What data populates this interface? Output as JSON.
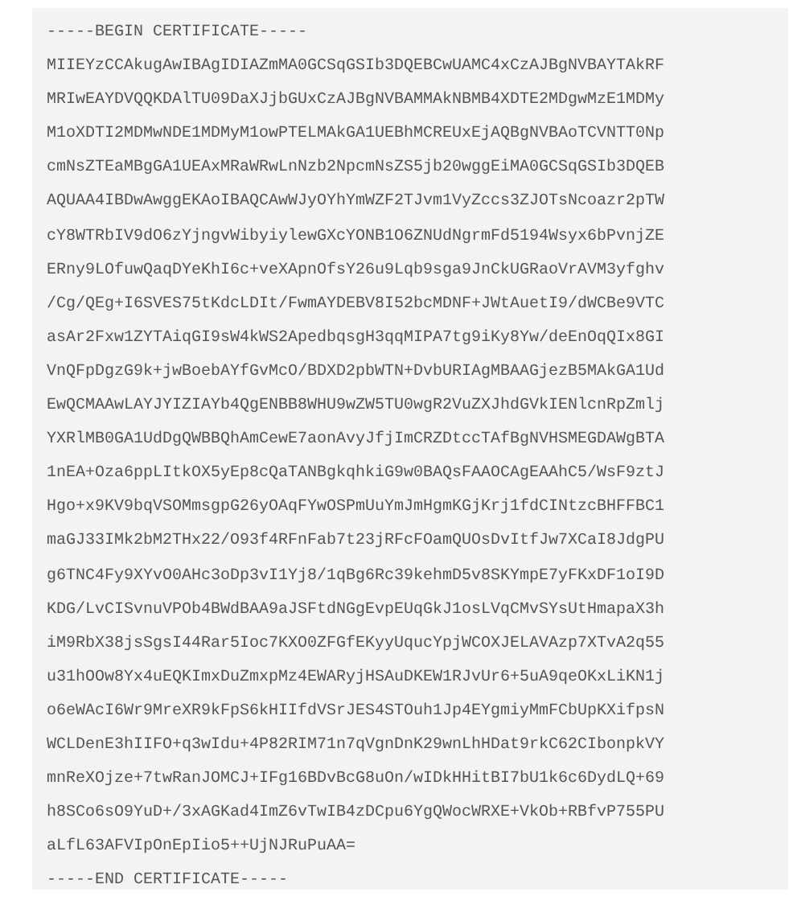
{
  "certificate": {
    "lines": [
      "-----BEGIN CERTIFICATE-----",
      "MIIEYzCCAkugAwIBAgIDIAZmMA0GCSqGSIb3DQEBCwUAMC4xCzAJBgNVBAYTAkRF",
      "MRIwEAYDVQQKDAlTU09DaXJjbGUxCzAJBgNVBAMMAkNBMB4XDTE2MDgwMzE1MDMy",
      "M1oXDTI2MDMwNDE1MDMyM1owPTELMAkGA1UEBhMCREUxEjAQBgNVBAoTCVNTT0Np",
      "cmNsZTEaMBgGA1UEAxMRaWRwLnNzb2NpcmNsZS5jb20wggEiMA0GCSqGSIb3DQEB",
      "AQUAA4IBDwAwggEKAoIBAQCAwWJyOYhYmWZF2TJvm1VyZccs3ZJOTsNcoazr2pTW",
      "cY8WTRbIV9dO6zYjngvWibyiylewGXcYONB1O6ZNUdNgrmFd5194Wsyx6bPvnjZE",
      "ERny9LOfuwQaqDYeKhI6c+veXApnOfsY26u9Lqb9sga9JnCkUGRaoVrAVM3yfghv",
      "/Cg/QEg+I6SVES75tKdcLDIt/FwmAYDEBV8I52bcMDNF+JWtAuetI9/dWCBe9VTC",
      "asAr2Fxw1ZYTAiqGI9sW4kWS2ApedbqsgH3qqMIPA7tg9iKy8Yw/deEnOqQIx8GI",
      "VnQFpDgzG9k+jwBoebAYfGvMcO/BDXD2pbWTN+DvbURIAgMBAAGjezB5MAkGA1Ud",
      "EwQCMAAwLAYJYIZIAYb4QgENBB8WHU9wZW5TU0wgR2VuZXJhdGVkIENlcnRpZmlj",
      "YXRlMB0GA1UdDgQWBBQhAmCewE7aonAvyJfjImCRZDtccTAfBgNVHSMEGDAWgBTA",
      "1nEA+Oza6ppLItkOX5yEp8cQaTANBgkqhkiG9w0BAQsFAAOCAgEAAhC5/WsF9ztJ",
      "Hgo+x9KV9bqVSOMmsgpG26yOAqFYwOSPmUuYmJmHgmKGjKrj1fdCINtzcBHFFBC1",
      "maGJ33IMk2bM2THx22/O93f4RFnFab7t23jRFcFOamQUOsDvItfJw7XCaI8JdgPU",
      "g6TNC4Fy9XYvO0AHc3oDp3vI1Yj8/1qBg6Rc39kehmD5v8SKYmpE7yFKxDF1oI9D",
      "KDG/LvCISvnuVPOb4BWdBAA9aJSFtdNGgEvpEUqGkJ1osLVqCMvSYsUtHmapaX3h",
      "iM9RbX38jsSgsI44Rar5Ioc7KXO0ZFGfEKyyUqucYpjWCOXJELAVAzp7XTvA2q55",
      "u31hOOw8Yx4uEQKImxDuZmxpMz4EWARyjHSAuDKEW1RJvUr6+5uA9qeOKxLiKN1j",
      "o6eWAcI6Wr9MreXR9kFpS6kHIIfdVSrJES4STOuh1Jp4EYgmiyMmFCbUpKXifpsN",
      "WCLDenE3hIIFO+q3wIdu+4P82RIM71n7qVgnDnK29wnLhHDat9rkC62CIbonpkVY",
      "mnReXOjze+7twRanJOMCJ+IFg16BDvBcG8uOn/wIDkHHitBI7bU1k6c6DydLQ+69",
      "h8SCo6sO9YuD+/3xAGKad4ImZ6vTwIB4zDCpu6YgQWocWRXE+VkOb+RBfvP755PU",
      "aLfL63AFVIpOnEpIio5++UjNJRuPuAA=",
      "-----END CERTIFICATE-----"
    ]
  }
}
